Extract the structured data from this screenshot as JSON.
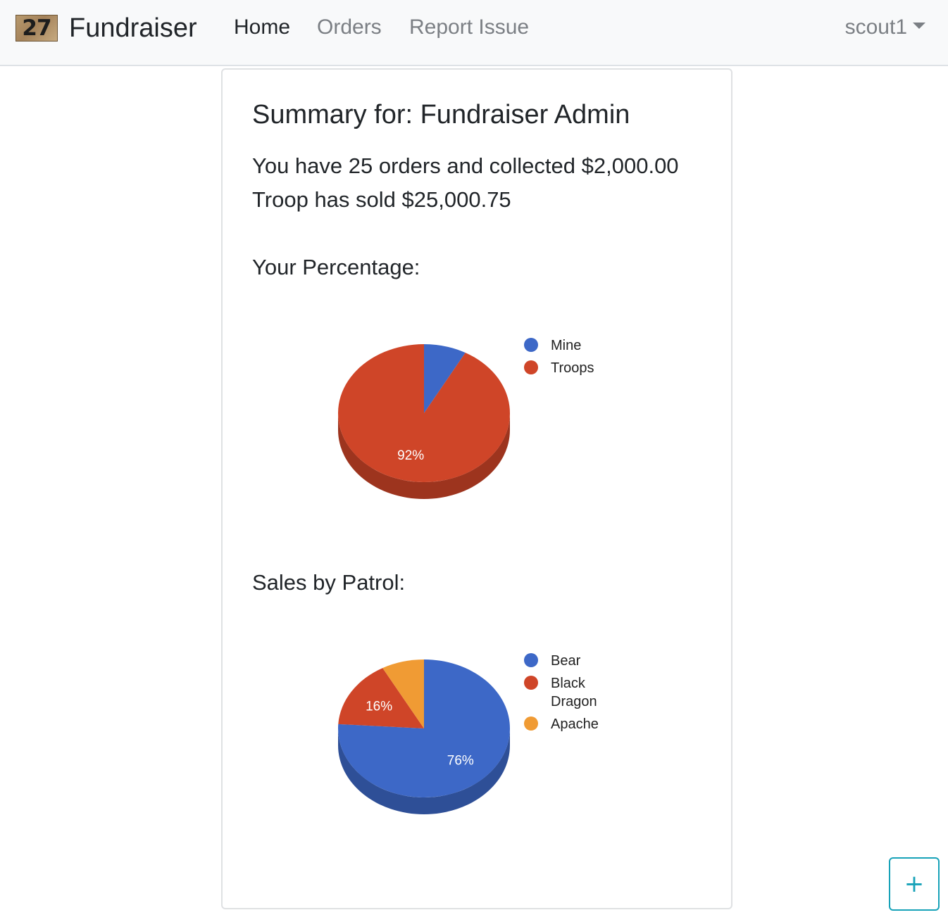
{
  "navbar": {
    "logo_text": "27",
    "brand": "Fundraiser",
    "links": [
      "Home",
      "Orders",
      "Report Issue"
    ],
    "active_link": "Home",
    "user": "scout1"
  },
  "summary": {
    "title": "Summary for: Fundraiser Admin",
    "orders_line": "You have 25 orders and collected $2,000.00",
    "troop_line": "Troop has sold $25,000.75"
  },
  "sections": {
    "percentage_heading": "Your Percentage:",
    "patrol_heading": "Sales by Patrol:"
  },
  "fab": {
    "icon": "plus-icon",
    "glyph": "+"
  },
  "chart_data": [
    {
      "type": "pie",
      "style": "3d",
      "title": "",
      "labels": [
        "Mine",
        "Troops"
      ],
      "values": [
        8,
        92
      ],
      "slice_labels": [
        "",
        "92%"
      ],
      "colors": [
        "#3d68c7",
        "#cf4528"
      ],
      "legend": "right"
    },
    {
      "type": "pie",
      "style": "3d",
      "title": "",
      "labels": [
        "Bear",
        "Black Dragon",
        "Apache"
      ],
      "legend_lines": [
        [
          "Bear"
        ],
        [
          "Black",
          "Dragon"
        ],
        [
          "Apache"
        ]
      ],
      "values": [
        76,
        16,
        8
      ],
      "slice_labels": [
        "76%",
        "16%",
        ""
      ],
      "colors": [
        "#3d68c7",
        "#cf4528",
        "#f09b34"
      ],
      "legend": "right"
    }
  ]
}
